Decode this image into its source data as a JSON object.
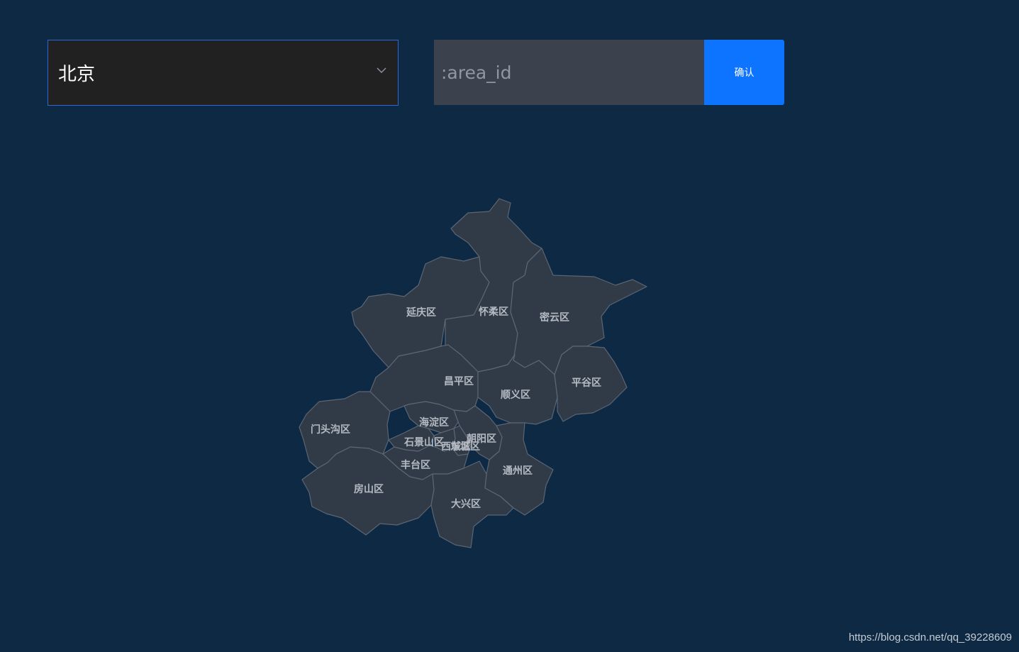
{
  "selector": {
    "value": "北京"
  },
  "area_input": {
    "placeholder": ":area_id",
    "value": ""
  },
  "confirm_button": {
    "label": "确认"
  },
  "map": {
    "region": "北京",
    "districts": [
      {
        "id": "yanqing",
        "name": "延庆区"
      },
      {
        "id": "huairou",
        "name": "怀柔区"
      },
      {
        "id": "miyun",
        "name": "密云区"
      },
      {
        "id": "changping",
        "name": "昌平区"
      },
      {
        "id": "shunyi",
        "name": "顺义区"
      },
      {
        "id": "pinggu",
        "name": "平谷区"
      },
      {
        "id": "mentougou",
        "name": "门头沟区"
      },
      {
        "id": "haidian",
        "name": "海淀区"
      },
      {
        "id": "shijingshan",
        "name": "石景山区"
      },
      {
        "id": "chaoyang",
        "name": "朝阳区"
      },
      {
        "id": "xicheng",
        "name": "西城区"
      },
      {
        "id": "dongcheng",
        "name": "东城区"
      },
      {
        "id": "fengtai",
        "name": "丰台区"
      },
      {
        "id": "tongzhou",
        "name": "通州区"
      },
      {
        "id": "fangshan",
        "name": "房山区"
      },
      {
        "id": "daxing",
        "name": "大兴区"
      }
    ]
  },
  "colors": {
    "background": "#0e2944",
    "district_fill": "#313b48",
    "button": "#0d74ff"
  },
  "watermark": "https://blog.csdn.net/qq_39228609"
}
